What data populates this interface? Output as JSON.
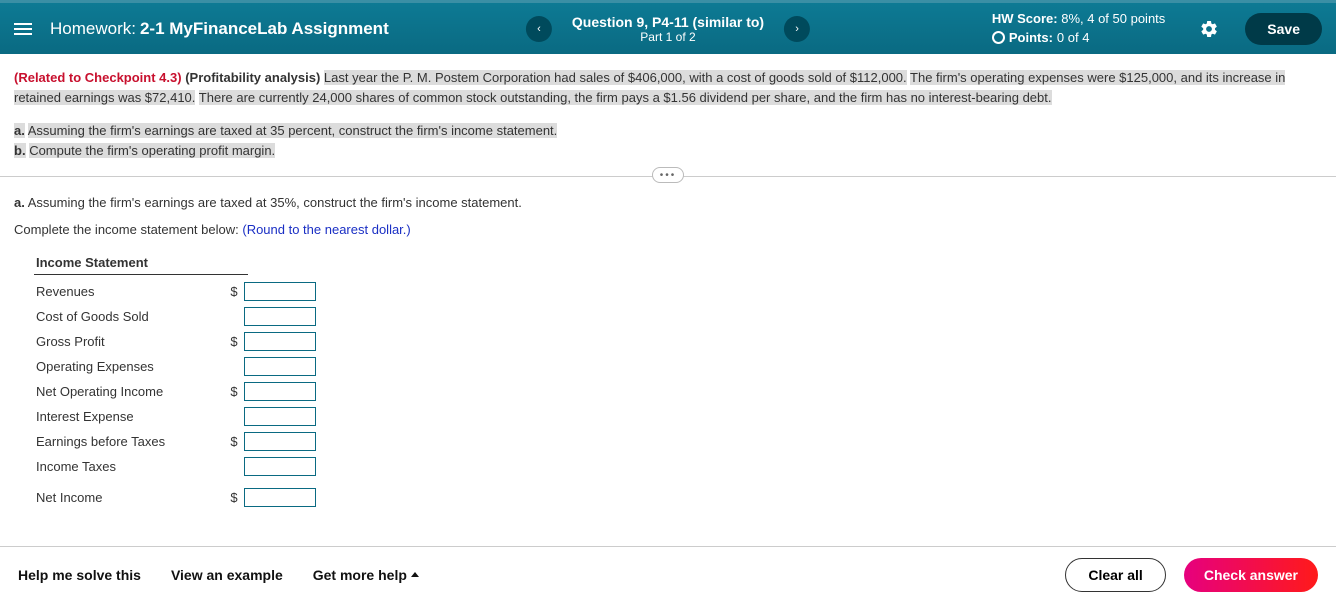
{
  "header": {
    "menu_icon": "menu",
    "hw_label": "Homework:",
    "hw_title": "2-1 MyFinanceLab Assignment",
    "prev": "‹",
    "next": "›",
    "question_title": "Question 9, P4-11 (similar to)",
    "question_sub": "Part 1 of 2",
    "hw_score_label": "HW Score:",
    "hw_score_value": "8%, 4 of 50 points",
    "points_label": "Points:",
    "points_value": "0 of 4",
    "save": "Save"
  },
  "problem": {
    "tag": "(Related to Checkpoint 4.3)",
    "topic": "(Profitability analysis)",
    "text1": "Last year the P. M. Postem Corporation had sales of $406,000, with a cost of goods sold of $112,000.",
    "text2": "The firm's operating expenses were $125,000, and its increase in retained earnings was $72,410.",
    "text3": "There are currently 24,000 shares of common stock outstanding, the firm pays a $1.56 dividend per share, and the firm has no interest-bearing debt.",
    "task_a_label": "a.",
    "task_a": "Assuming the firm's earnings are taxed at 35 percent, construct the firm's income statement.",
    "task_b_label": "b.",
    "task_b": "Compute the firm's operating profit margin."
  },
  "work": {
    "part_a_label": "a.",
    "part_a_text": "Assuming the firm's earnings are taxed at 35%, construct the firm's income statement.",
    "complete": "Complete the income statement below:",
    "round": "(Round to the nearest dollar.)",
    "stmt_title": "Income Statement",
    "rows": [
      {
        "label": "Revenues",
        "dollar": "$"
      },
      {
        "label": "Cost of Goods Sold",
        "dollar": ""
      },
      {
        "label": "Gross Profit",
        "dollar": "$"
      },
      {
        "label": "Operating Expenses",
        "dollar": ""
      },
      {
        "label": "Net Operating Income",
        "dollar": "$"
      },
      {
        "label": "Interest Expense",
        "dollar": ""
      },
      {
        "label": "Earnings before Taxes",
        "dollar": "$"
      },
      {
        "label": "Income Taxes",
        "dollar": ""
      },
      {
        "label": "Net Income",
        "dollar": "$"
      }
    ]
  },
  "footer": {
    "help": "Help me solve this",
    "example": "View an example",
    "more": "Get more help",
    "clear": "Clear all",
    "check": "Check answer"
  }
}
